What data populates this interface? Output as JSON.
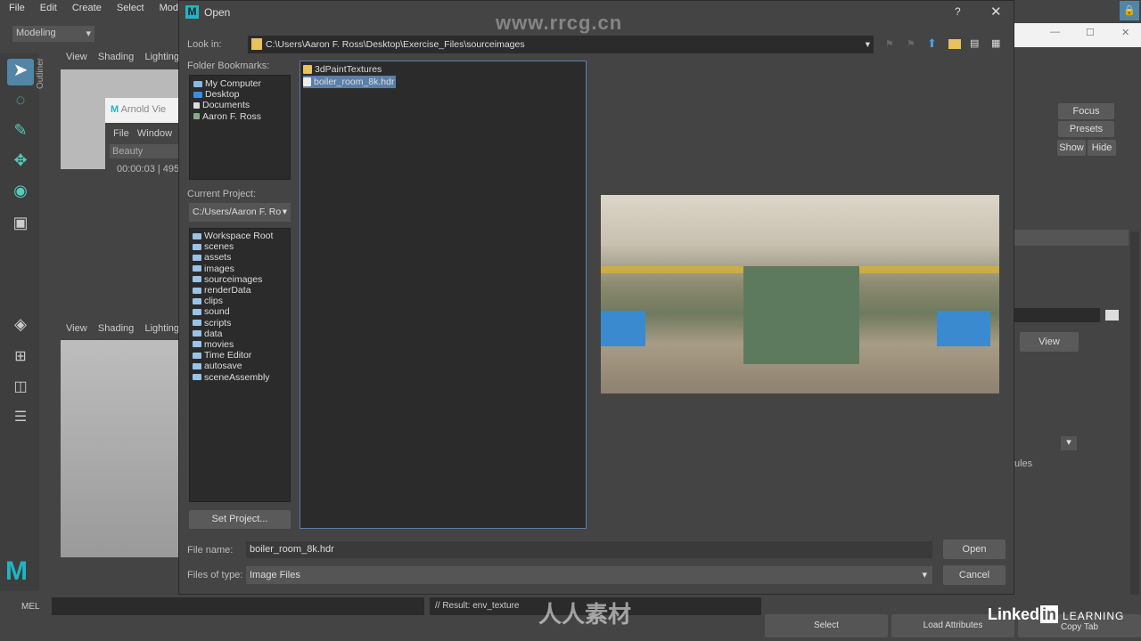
{
  "maya": {
    "menu": [
      "File",
      "Edit",
      "Create",
      "Select",
      "Modify"
    ],
    "mode": "Modeling",
    "outliner": "Outliner",
    "viewport_menu": [
      "View",
      "Shading",
      "Lighting"
    ],
    "arnold": {
      "title": "Arnold Vie",
      "menu": [
        "File",
        "Window"
      ],
      "aov": "Beauty",
      "time": "00:00:03 | 495"
    },
    "right": {
      "focus": "Focus",
      "presets": "Presets",
      "show": "Show",
      "hide": "Hide",
      "view": "View",
      "rules": "ules"
    },
    "bottom": {
      "mel": "MEL",
      "result": "// Result: env_texture",
      "select": "Select",
      "load_attributes": "Load Attributes",
      "copy_tab": "Copy Tab"
    }
  },
  "dialog": {
    "title": "Open",
    "help": "?",
    "look_in_label": "Look in:",
    "look_in": "C:\\Users\\Aaron F. Ross\\Desktop\\Exercise_Files\\sourceimages",
    "bookmarks_label": "Folder Bookmarks:",
    "bookmarks": [
      "My Computer",
      "Desktop",
      "Documents",
      "Aaron F. Ross"
    ],
    "project_label": "Current Project:",
    "project": "C:/Users/Aaron F. Ro",
    "project_folders": [
      "Workspace Root",
      "scenes",
      "assets",
      "images",
      "sourceimages",
      "renderData",
      "clips",
      "sound",
      "scripts",
      "data",
      "movies",
      "Time Editor",
      "autosave",
      "sceneAssembly"
    ],
    "set_project": "Set Project...",
    "files": [
      {
        "name": "3dPaintTextures",
        "type": "folder",
        "selected": false
      },
      {
        "name": "boiler_room_8k.hdr",
        "type": "file",
        "selected": true
      }
    ],
    "file_name_label": "File name:",
    "file_name": "boiler_room_8k.hdr",
    "type_label": "Files of type:",
    "file_type": "Image Files",
    "open": "Open",
    "cancel": "Cancel"
  },
  "watermark": {
    "site": "www.rrcg.cn",
    "brand": "人人素材",
    "linkedin": "Linked",
    "learning": "LEARNING"
  },
  "colors": {
    "accent": "#5285a6",
    "selection": "#5a7fa8"
  }
}
